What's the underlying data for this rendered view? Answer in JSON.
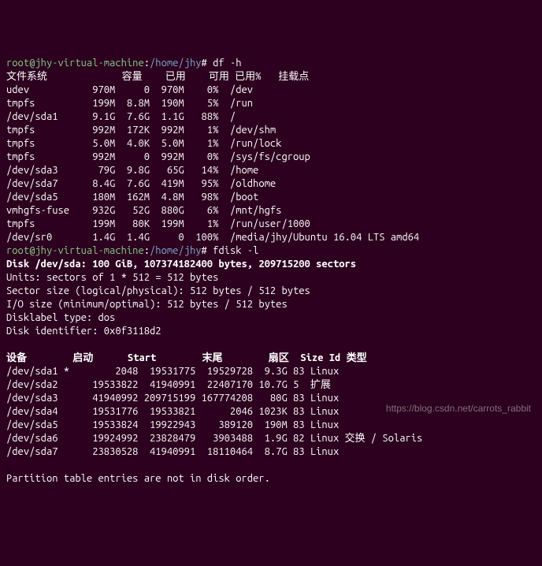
{
  "prompt": {
    "user": "root",
    "host": "jhy-virtual-machine",
    "path": "/home/jhy",
    "symbol": "#"
  },
  "commands": {
    "df": "df -h",
    "fdisk": "fdisk -l"
  },
  "df": {
    "header": [
      "文件系统",
      "容量",
      "已用",
      "可用",
      "已用%",
      "挂载点"
    ],
    "rows": [
      {
        "fs": "udev",
        "size": "970M",
        "used": "0",
        "avail": "970M",
        "usep": "0%",
        "mount": "/dev"
      },
      {
        "fs": "tmpfs",
        "size": "199M",
        "used": "8.8M",
        "avail": "190M",
        "usep": "5%",
        "mount": "/run"
      },
      {
        "fs": "/dev/sda1",
        "size": "9.1G",
        "used": "7.6G",
        "avail": "1.1G",
        "usep": "88%",
        "mount": "/"
      },
      {
        "fs": "tmpfs",
        "size": "992M",
        "used": "172K",
        "avail": "992M",
        "usep": "1%",
        "mount": "/dev/shm"
      },
      {
        "fs": "tmpfs",
        "size": "5.0M",
        "used": "4.0K",
        "avail": "5.0M",
        "usep": "1%",
        "mount": "/run/lock"
      },
      {
        "fs": "tmpfs",
        "size": "992M",
        "used": "0",
        "avail": "992M",
        "usep": "0%",
        "mount": "/sys/fs/cgroup"
      },
      {
        "fs": "/dev/sda3",
        "size": "79G",
        "used": "9.8G",
        "avail": "65G",
        "usep": "14%",
        "mount": "/home"
      },
      {
        "fs": "/dev/sda7",
        "size": "8.4G",
        "used": "7.6G",
        "avail": "419M",
        "usep": "95%",
        "mount": "/oldhome"
      },
      {
        "fs": "/dev/sda5",
        "size": "180M",
        "used": "162M",
        "avail": "4.8M",
        "usep": "98%",
        "mount": "/boot"
      },
      {
        "fs": "vmhgfs-fuse",
        "size": "932G",
        "used": "52G",
        "avail": "880G",
        "usep": "6%",
        "mount": "/mnt/hgfs"
      },
      {
        "fs": "tmpfs",
        "size": "199M",
        "used": "80K",
        "avail": "199M",
        "usep": "1%",
        "mount": "/run/user/1000"
      },
      {
        "fs": "/dev/sr0",
        "size": "1.4G",
        "used": "1.4G",
        "avail": "0",
        "usep": "100%",
        "mount": "/media/jhy/Ubuntu 16.04 LTS amd64"
      }
    ]
  },
  "fdisk": {
    "summary": "Disk /dev/sda: 100 GiB, 107374182400 bytes, 209715200 sectors",
    "units": "Units: sectors of 1 * 512 = 512 bytes",
    "sector": "Sector size (logical/physical): 512 bytes / 512 bytes",
    "io": "I/O size (minimum/optimal): 512 bytes / 512 bytes",
    "labeltype": "Disklabel type: dos",
    "identifier": "Disk identifier: 0x0f3118d2",
    "header": [
      "设备",
      "启动",
      "Start",
      "末尾",
      "扇区",
      "Size",
      "Id",
      "类型"
    ],
    "rows": [
      {
        "dev": "/dev/sda1",
        "boot": "*",
        "start": "2048",
        "end": "19531775",
        "sectors": "19529728",
        "size": "9.3G",
        "id": "83",
        "type": "Linux"
      },
      {
        "dev": "/dev/sda2",
        "boot": "",
        "start": "19533822",
        "end": "41940991",
        "sectors": "22407170",
        "size": "10.7G",
        "id": "5",
        "type": "扩展"
      },
      {
        "dev": "/dev/sda3",
        "boot": "",
        "start": "41940992",
        "end": "209715199",
        "sectors": "167774208",
        "size": "80G",
        "id": "83",
        "type": "Linux"
      },
      {
        "dev": "/dev/sda4",
        "boot": "",
        "start": "19531776",
        "end": "19533821",
        "sectors": "2046",
        "size": "1023K",
        "id": "83",
        "type": "Linux"
      },
      {
        "dev": "/dev/sda5",
        "boot": "",
        "start": "19533824",
        "end": "19922943",
        "sectors": "389120",
        "size": "190M",
        "id": "83",
        "type": "Linux"
      },
      {
        "dev": "/dev/sda6",
        "boot": "",
        "start": "19924992",
        "end": "23828479",
        "sectors": "3903488",
        "size": "1.9G",
        "id": "82",
        "type": "Linux 交换 / Solaris"
      },
      {
        "dev": "/dev/sda7",
        "boot": "",
        "start": "23830528",
        "end": "41940991",
        "sectors": "18110464",
        "size": "8.7G",
        "id": "83",
        "type": "Linux"
      }
    ],
    "note": "Partition table entries are not in disk order."
  },
  "watermark": "https://blog.csdn.net/carrots_rabbit"
}
